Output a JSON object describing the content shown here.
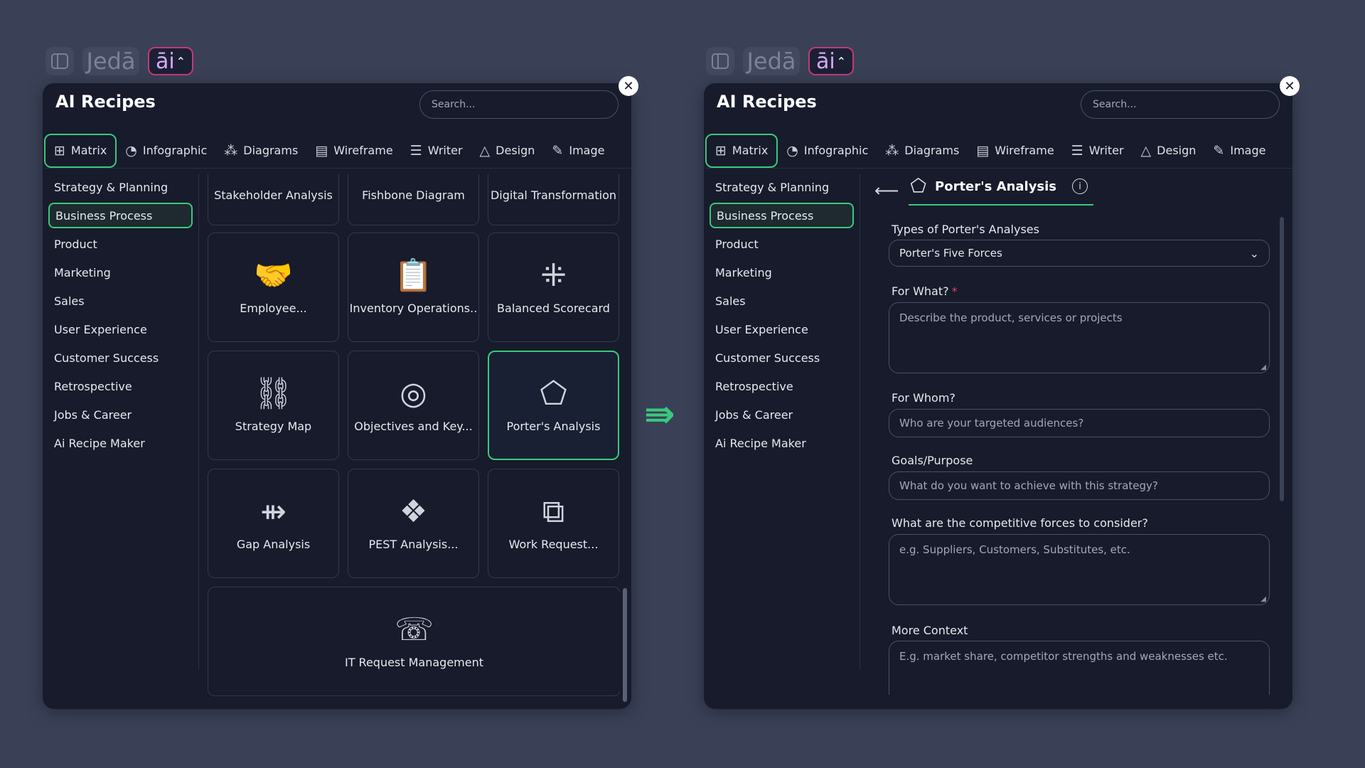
{
  "topbar": {
    "brand": "Jedā",
    "ai_label": "āi",
    "caret": "^"
  },
  "panel_title": "AI Recipes",
  "search_placeholder": "Search...",
  "tabs": [
    {
      "label": "Matrix",
      "icon": "grid-icon"
    },
    {
      "label": "Infographic",
      "icon": "pie-icon"
    },
    {
      "label": "Diagrams",
      "icon": "diagram-icon"
    },
    {
      "label": "Wireframe",
      "icon": "wireframe-icon"
    },
    {
      "label": "Writer",
      "icon": "writer-icon"
    },
    {
      "label": "Design",
      "icon": "design-icon"
    },
    {
      "label": "Image",
      "icon": "image-icon"
    }
  ],
  "sidebar": [
    "Strategy & Planning",
    "Business Process",
    "Product",
    "Marketing",
    "Sales",
    "User Experience",
    "Customer Success",
    "Retrospective",
    "Jobs & Career",
    "Ai Recipe Maker"
  ],
  "cards": {
    "stakeholder": "Stakeholder Analysis",
    "fishbone": "Fishbone Diagram",
    "digital": "Digital Transformation",
    "employee": "Employee...",
    "inventory": "Inventory Operations..",
    "balanced": "Balanced Scorecard",
    "strategy_map": "Strategy Map",
    "objectives": "Objectives and Key...",
    "porters": "Porter's Analysis",
    "gap": "Gap Analysis",
    "pest": "PEST Analysis...",
    "work_request": "Work Request...",
    "it_request": "IT Request Management"
  },
  "detail": {
    "title": "Porter's Analysis",
    "info": "i",
    "types_label": "Types of Porter's Analyses",
    "types_value": "Porter's Five Forces",
    "for_what_label": "For What?",
    "required_mark": "*",
    "for_what_placeholder": "Describe the product, services or projects",
    "for_whom_label": "For Whom?",
    "for_whom_placeholder": "Who are your targeted audiences?",
    "goals_label": "Goals/Purpose",
    "goals_placeholder": "What do you want to achieve with this strategy?",
    "forces_label": "What are the competitive forces to consider?",
    "forces_placeholder": "e.g. Suppliers, Customers, Substitutes, etc.",
    "context_label": "More Context",
    "context_placeholder": "E.g. market share, competitor strengths and weaknesses etc."
  },
  "colors": {
    "accent": "#39c97d",
    "panel": "#171b2b",
    "background": "#3a4157",
    "ai_border": "#c33a78"
  }
}
